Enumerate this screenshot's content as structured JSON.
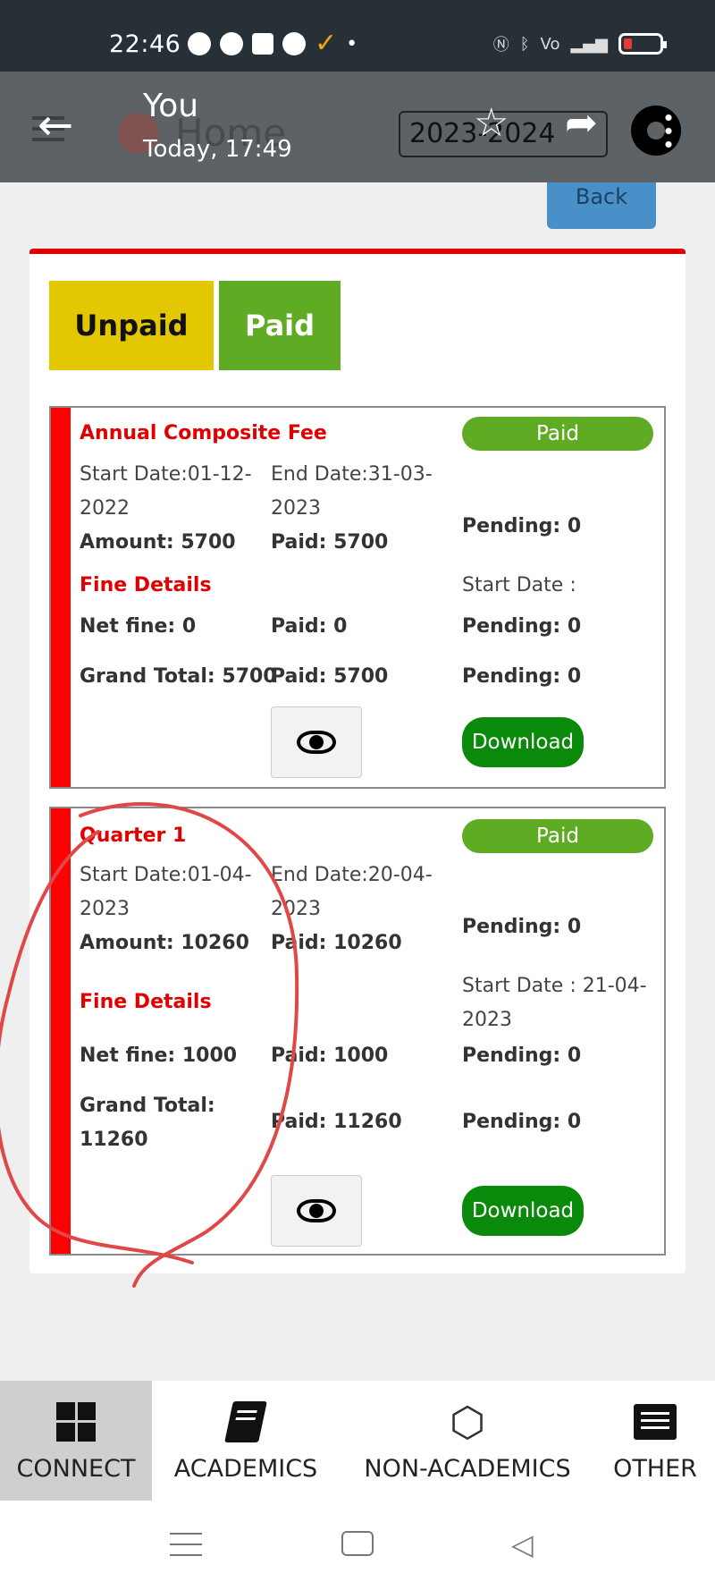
{
  "status_bar": {
    "time": "22:46"
  },
  "top_bar": {
    "sender": "You",
    "sent_time": "Today, 17:49",
    "underlying_title": "Home",
    "year_select": "2023-2024",
    "back_button_label": "Back"
  },
  "tabs": {
    "unpaid": "Unpaid",
    "paid": "Paid"
  },
  "fees": [
    {
      "title": "Annual Composite Fee",
      "status": "Paid",
      "start_date": "Start Date:01-12-2022",
      "end_date": "End Date:31-03-2023",
      "amount": "Amount: 5700",
      "paid": "Paid: 5700",
      "pending": "Pending: 0",
      "fine_header": "Fine Details",
      "fine_start": "Start Date :",
      "net_fine": "Net fine: 0",
      "fine_paid": "Paid: 0",
      "fine_pending": "Pending: 0",
      "grand_total": "Grand Total: 5700",
      "total_paid": "Paid: 5700",
      "total_pending": "Pending: 0",
      "download_label": "Download"
    },
    {
      "title": "Quarter 1",
      "status": "Paid",
      "start_date": "Start Date:01-04-2023",
      "end_date": "End Date:20-04-2023",
      "amount": "Amount: 10260",
      "paid": "Paid: 10260",
      "pending": "Pending: 0",
      "fine_header": "Fine Details",
      "fine_start": "Start Date : 21-04-2023",
      "net_fine": "Net fine: 1000",
      "fine_paid": "Paid: 1000",
      "fine_pending": "Pending: 0",
      "grand_total": "Grand Total: 11260",
      "total_paid": "Paid: 11260",
      "total_pending": "Pending: 0",
      "download_label": "Download"
    }
  ],
  "bottom_nav": [
    {
      "label": "CONNECT",
      "icon": "windows-icon",
      "active": true
    },
    {
      "label": "ACADEMICS",
      "icon": "book-icon",
      "active": false
    },
    {
      "label": "NON-ACADEMICS",
      "icon": "hexagon-icon",
      "active": false
    },
    {
      "label": "OTHER",
      "icon": "list-icon",
      "active": false
    }
  ],
  "colors": {
    "accent_red": "#e00000",
    "paid_green": "#5fac24",
    "unpaid_yellow": "#e3c700",
    "download_green": "#0a8a0a",
    "annotation_red": "#e04848"
  }
}
